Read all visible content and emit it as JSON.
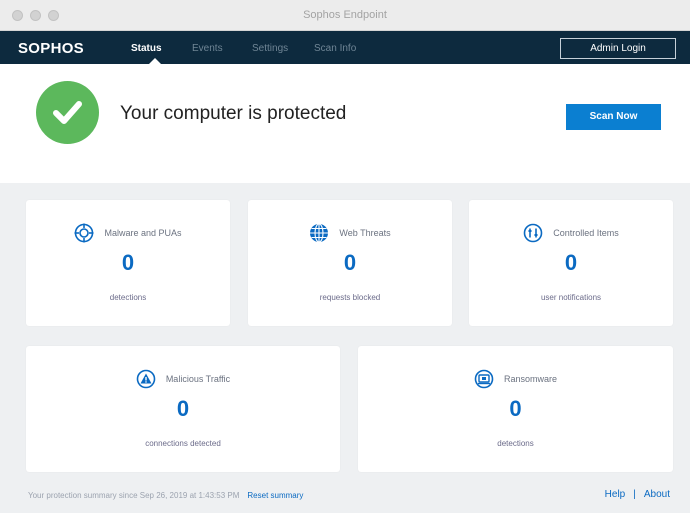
{
  "window": {
    "title": "Sophos Endpoint"
  },
  "nav": {
    "brand": "SOPHOS",
    "tabs": [
      {
        "label": "Status",
        "active": true
      },
      {
        "label": "Events",
        "active": false
      },
      {
        "label": "Settings",
        "active": false
      },
      {
        "label": "Scan Info",
        "active": false
      }
    ],
    "admin_login_label": "Admin Login"
  },
  "status": {
    "message": "Your computer is protected",
    "scan_button_label": "Scan Now",
    "icon": "check-icon"
  },
  "cards": [
    {
      "title": "Malware and PUAs",
      "value": "0",
      "subtitle": "detections",
      "icon": "malware-target-icon"
    },
    {
      "title": "Web Threats",
      "value": "0",
      "subtitle": "requests blocked",
      "icon": "globe-icon"
    },
    {
      "title": "Controlled Items",
      "value": "0",
      "subtitle": "user notifications",
      "icon": "controlled-items-icon"
    },
    {
      "title": "Malicious Traffic",
      "value": "0",
      "subtitle": "connections detected",
      "icon": "warning-triangle-icon"
    },
    {
      "title": "Ransomware",
      "value": "0",
      "subtitle": "detections",
      "icon": "ransomware-icon"
    }
  ],
  "footer": {
    "summary": "Your protection summary since Sep 26, 2019 at 1:43:53 PM",
    "reset_label": "Reset summary",
    "help_label": "Help",
    "separator": "|",
    "about_label": "About"
  },
  "colors": {
    "nav_background": "#0d2a3e",
    "accent_blue": "#0b7fd1",
    "success_green": "#5cb85c",
    "panel_background": "#eef0f2"
  }
}
